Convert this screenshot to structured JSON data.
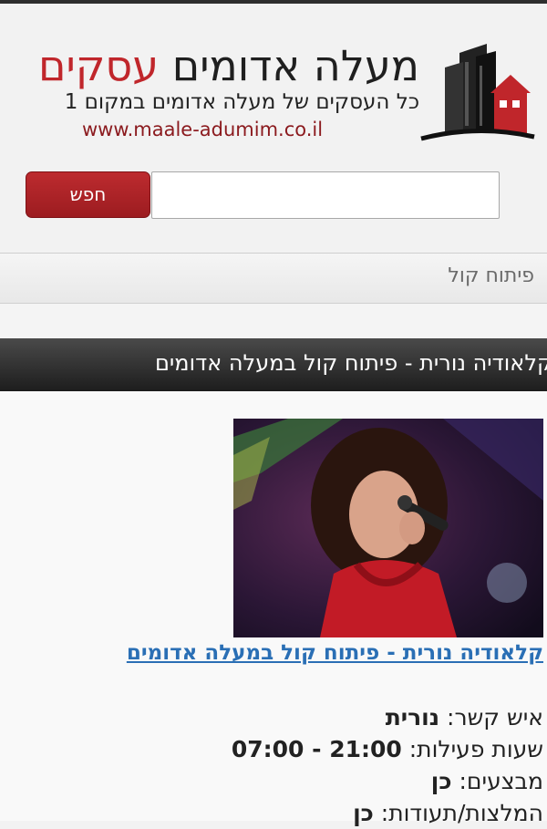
{
  "header": {
    "title_part1": "מעלה אדומים",
    "title_part2": "עסקים",
    "subtitle": "כל העסקים של מעלה אדומים במקום 1",
    "url": "www.maale-adumim.co.il",
    "colors": {
      "brand_red": "#c0262b",
      "dark": "#1f1f1f"
    }
  },
  "search": {
    "value": "",
    "button_label": "חפש"
  },
  "breadcrumb": {
    "current": "פיתוח קול"
  },
  "page": {
    "title": "קלאודיה נורית - פיתוח קול במעלה אדומים"
  },
  "business": {
    "photo_icon": "singer-photo",
    "link_text": "קלאודיה נורית - פיתוח קול במעלה אדומים",
    "details": [
      {
        "label": "איש קשר:",
        "value": "נורית"
      },
      {
        "label": "שעות פעילות:",
        "value": "21:00 - 07:00"
      },
      {
        "label": "מבצעים:",
        "value": "כן"
      },
      {
        "label": "המלצות/תעודות:",
        "value": "כן"
      }
    ]
  }
}
